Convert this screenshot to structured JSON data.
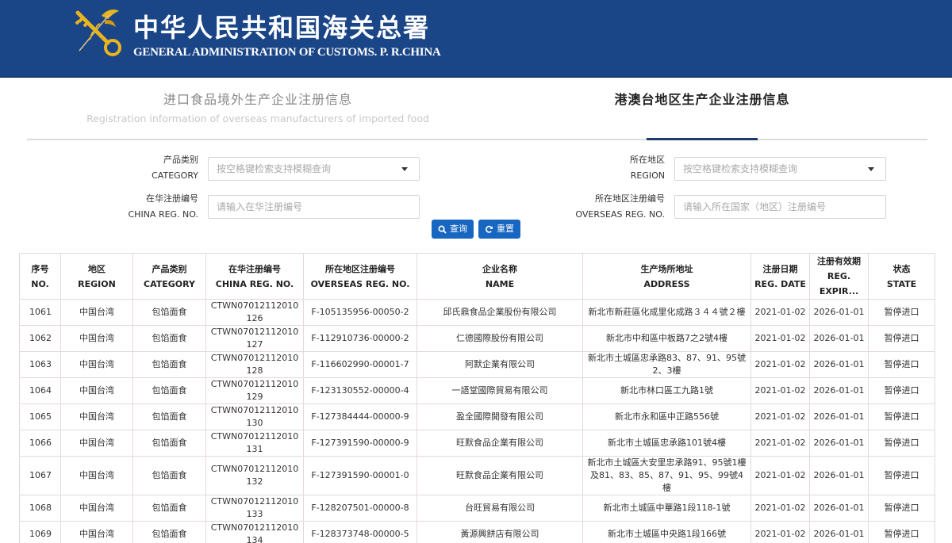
{
  "header": {
    "title_cn": "中华人民共和国海关总署",
    "title_en": "GENERAL ADMINISTRATION OF CUSTOMS. P. R.CHINA",
    "logo_icon": "customs-key-emblem-icon",
    "colors": {
      "banner": "#1a4586",
      "logo_gold": "#e8b420"
    }
  },
  "tabs": [
    {
      "label_cn": "进口食品境外生产企业注册信息",
      "label_en": "Registration information of overseas manufacturers of imported food",
      "active": false
    },
    {
      "label_cn": "港澳台地区生产企业注册信息",
      "label_en": "",
      "active": true
    }
  ],
  "form": {
    "category": {
      "label_cn": "产品类别",
      "label_en": "CATEGORY",
      "placeholder": "按空格键检索支持模糊查询",
      "value": ""
    },
    "region": {
      "label_cn": "所在地区",
      "label_en": "REGION",
      "placeholder": "按空格键检索支持模糊查询",
      "value": ""
    },
    "china_reg_no": {
      "label_cn": "在华注册编号",
      "label_en": "CHINA REG. NO.",
      "placeholder": "请输入在华注册编号",
      "value": ""
    },
    "overseas_reg_no": {
      "label_cn": "所在地区注册编号",
      "label_en": "OVERSEAS REG. NO.",
      "placeholder": "请输入所在国家（地区）注册编号",
      "value": ""
    },
    "search_button": {
      "label": "查询",
      "icon": "search-icon"
    },
    "reset_button": {
      "label": "重置",
      "icon": "refresh-icon"
    },
    "button_color": "#1766c1"
  },
  "table": {
    "columns": [
      {
        "cn": "序号",
        "en": "NO."
      },
      {
        "cn": "地区",
        "en": "REGION"
      },
      {
        "cn": "产品类别",
        "en": "CATEGORY"
      },
      {
        "cn": "在华注册编号",
        "en": "CHINA REG. NO."
      },
      {
        "cn": "所在地区注册编号",
        "en": "OVERSEAS REG. NO."
      },
      {
        "cn": "企业名称",
        "en": "NAME"
      },
      {
        "cn": "生产场所地址",
        "en": "ADDRESS"
      },
      {
        "cn": "注册日期",
        "en": "REG. DATE"
      },
      {
        "cn": "注册有效期",
        "en": "REG. EXPIR..."
      },
      {
        "cn": "状态",
        "en": "STATE"
      }
    ],
    "rows": [
      {
        "no": "1061",
        "region": "中国台湾",
        "category": "包馅面食",
        "china_reg": "CTWN07012112010126",
        "overseas_reg": "F-105135956-00050-2",
        "name": "邱氏鼎食品企業股份有限公司",
        "address": "新北市新莊區化成里化成路３４４號２樓",
        "reg_date": "2021-01-02",
        "expiry": "2026-01-01",
        "state": "暂停进口"
      },
      {
        "no": "1062",
        "region": "中国台湾",
        "category": "包馅面食",
        "china_reg": "CTWN07012112010127",
        "overseas_reg": "F-112910736-00000-2",
        "name": "仁德國際股份有限公司",
        "address": "新北市中和區中板路7之2號4樓",
        "reg_date": "2021-01-02",
        "expiry": "2026-01-01",
        "state": "暂停进口"
      },
      {
        "no": "1063",
        "region": "中国台湾",
        "category": "包馅面食",
        "china_reg": "CTWN07012112010128",
        "overseas_reg": "F-116602990-00001-7",
        "name": "阿默企業有限公司",
        "address": "新北市土城區忠承路83、87、91、95號2、3樓",
        "reg_date": "2021-01-02",
        "expiry": "2026-01-01",
        "state": "暂停进口"
      },
      {
        "no": "1064",
        "region": "中国台湾",
        "category": "包馅面食",
        "china_reg": "CTWN07012112010129",
        "overseas_reg": "F-123130552-00000-4",
        "name": "一語堂國際貿易有限公司",
        "address": "新北市林口區工九路1號",
        "reg_date": "2021-01-02",
        "expiry": "2026-01-01",
        "state": "暂停进口"
      },
      {
        "no": "1065",
        "region": "中国台湾",
        "category": "包馅面食",
        "china_reg": "CTWN07012112010130",
        "overseas_reg": "F-127384444-00000-9",
        "name": "盈全國際開發有限公司",
        "address": "新北市永和區中正路556號",
        "reg_date": "2021-01-02",
        "expiry": "2026-01-01",
        "state": "暂停进口"
      },
      {
        "no": "1066",
        "region": "中国台湾",
        "category": "包馅面食",
        "china_reg": "CTWN07012112010131",
        "overseas_reg": "F-127391590-00000-9",
        "name": "旺默食品企業有限公司",
        "address": "新北市土城區忠承路101號4樓",
        "reg_date": "2021-01-02",
        "expiry": "2026-01-01",
        "state": "暂停进口"
      },
      {
        "no": "1067",
        "region": "中国台湾",
        "category": "包馅面食",
        "china_reg": "CTWN07012112010132",
        "overseas_reg": "F-127391590-00001-0",
        "name": "旺默食品企業有限公司",
        "address": "新北市土城區大安里忠承路91、95號1樓及81、83、85、87、91、95、99號4樓",
        "reg_date": "2021-01-02",
        "expiry": "2026-01-01",
        "state": "暂停进口"
      },
      {
        "no": "1068",
        "region": "中国台湾",
        "category": "包馅面食",
        "china_reg": "CTWN07012112010133",
        "overseas_reg": "F-128207501-00000-8",
        "name": "台旺貿易有限公司",
        "address": "新北市土城區中華路1段118-1號",
        "reg_date": "2021-01-02",
        "expiry": "2026-01-01",
        "state": "暂停进口"
      },
      {
        "no": "1069",
        "region": "中国台湾",
        "category": "包馅面食",
        "china_reg": "CTWN07012112010134",
        "overseas_reg": "F-128373748-00000-5",
        "name": "黃源興餅店有限公司",
        "address": "新北市土城區中央路1段166號",
        "reg_date": "2021-01-02",
        "expiry": "2026-01-01",
        "state": "暂停进口"
      }
    ]
  }
}
